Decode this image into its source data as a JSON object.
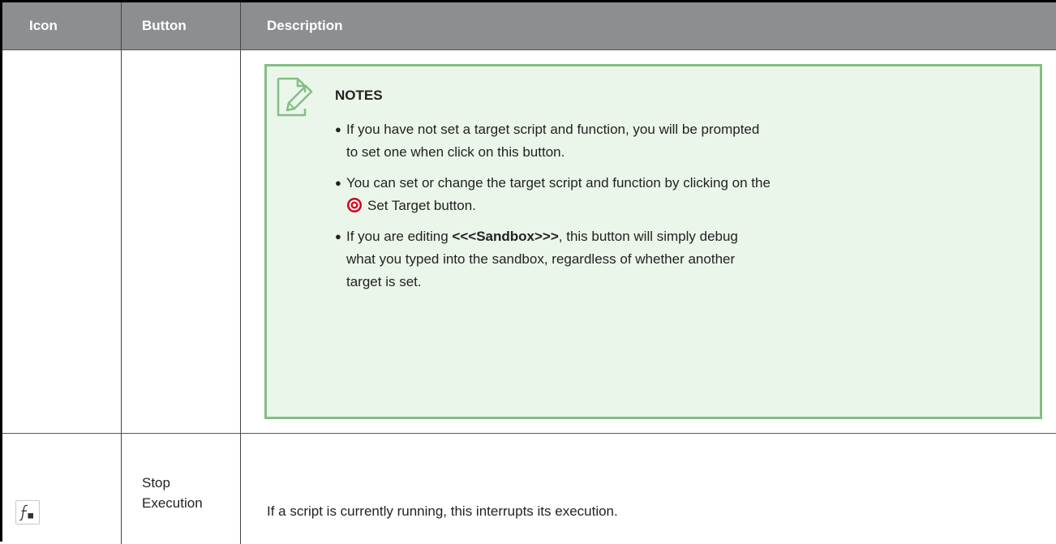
{
  "table": {
    "headers": {
      "icon": "Icon",
      "button": "Button",
      "description": "Description"
    },
    "note": {
      "title": "NOTES",
      "items": [
        {
          "line1": "If you have not set a target script and function, you will be prompted",
          "line2": "to set one when click on this button."
        },
        {
          "line1": "You can set or change the target script and function by clicking on the",
          "line2": "Set Target button."
        },
        {
          "prefix": "If you are editing ",
          "bold": "<<<Sandbox>>>",
          "suffix": ", this button will simply debug",
          "line2": "what you typed into the sandbox, regardless of whether another",
          "line3": "target is set."
        }
      ]
    },
    "rows": [
      {
        "icon_name": "function-stop-icon",
        "button_line1": "Stop",
        "button_line2": "Execution",
        "description": "If a script is currently running, this interrupts its execution."
      }
    ]
  },
  "colors": {
    "header_bg": "#8d8e91",
    "note_bg": "#ebf6ea",
    "note_border": "#86bd84",
    "target_icon": "#d0021b"
  }
}
